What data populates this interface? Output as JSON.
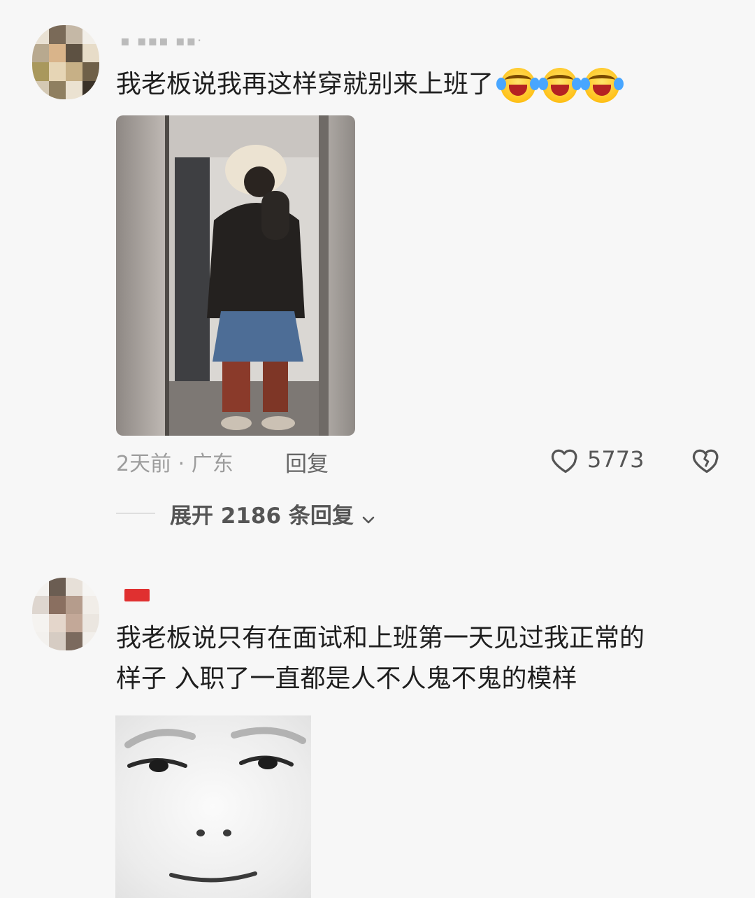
{
  "comments": [
    {
      "username": "▪ ▪▪▪ ▪▪·",
      "text": "我老板说我再这样穿就别来上班了",
      "emojis": [
        "crying-laughing-emoji",
        "crying-laughing-emoji",
        "crying-laughing-emoji"
      ],
      "time_location": "2天前 · 广东",
      "reply_label": "回复",
      "likes": "5773",
      "expand_label": "展开 2186 条回复"
    },
    {
      "username": "",
      "text_line1": "我老板说只有在面试和上班第一天见过我正常的",
      "text_line2": "样子 入职了一直都是人不人鬼不鬼的模样"
    }
  ],
  "colors": {
    "background": "#f7f7f7",
    "text": "#1f1f1f",
    "meta": "#9d9d9d",
    "badge_red": "#e03030"
  }
}
